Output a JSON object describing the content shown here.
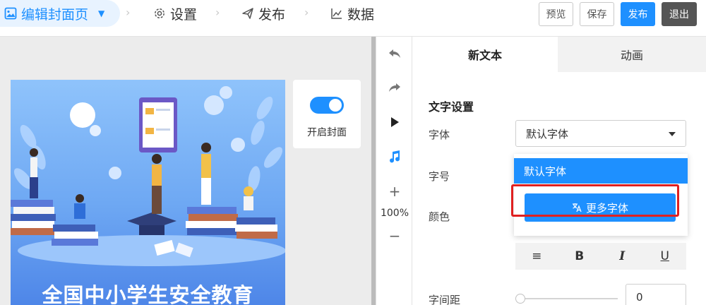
{
  "header": {
    "active_crumb": "编辑封面页",
    "crumbs": [
      "设置",
      "发布",
      "数据"
    ],
    "buttons": {
      "preview": "预览",
      "save": "保存",
      "publish": "发布",
      "exit": "退出"
    }
  },
  "canvas": {
    "poster_title": "全国中小学生安全教育",
    "cover_toggle_label": "开启封面",
    "cover_toggle_on": true
  },
  "toolbar": {
    "zoom": "100%"
  },
  "panel": {
    "tabs": [
      "新文本",
      "动画"
    ],
    "section_title": "文字设置",
    "labels": {
      "font": "字体",
      "size": "字号",
      "color": "颜色",
      "spacing": "字间距"
    },
    "font_value": "默认字体",
    "dropdown": {
      "option": "默认字体",
      "more_button": "更多字体"
    },
    "format_buttons": [
      "≡",
      "B",
      "I",
      "U"
    ],
    "letter_spacing_value": "0"
  },
  "colors": {
    "accent": "#1e90ff",
    "highlight": "#e02020",
    "exit_button": "#555555"
  }
}
